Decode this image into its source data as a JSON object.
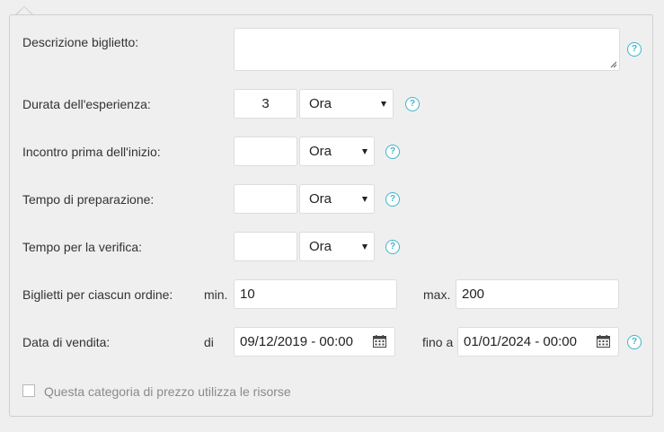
{
  "form": {
    "description": {
      "label": "Descrizione biglietto:",
      "value": ""
    },
    "duration": {
      "label": "Durata dell'esperienza:",
      "value": "3",
      "unit": "Ora"
    },
    "meeting": {
      "label": "Incontro prima dell'inizio:",
      "value": "",
      "unit": "Ora"
    },
    "prep": {
      "label": "Tempo di preparazione:",
      "value": "",
      "unit": "Ora"
    },
    "verify": {
      "label": "Tempo per la verifica:",
      "value": "",
      "unit": "Ora"
    },
    "tickets": {
      "label": "Biglietti per ciascun ordine:",
      "min_label": "min.",
      "min_value": "10",
      "max_label": "max.",
      "max_value": "200"
    },
    "sale_date": {
      "label": "Data di vendita:",
      "from_label": "di",
      "from_value": "09/12/2019 - 00:00",
      "to_label": "fino a",
      "to_value": "01/01/2024 - 00:00"
    },
    "resources_checkbox": {
      "label": "Questa categoria di prezzo utilizza le risorse",
      "checked": false
    }
  },
  "help_glyph": "?",
  "colors": {
    "help_accent": "#3eb5c9",
    "background": "#efefef"
  }
}
